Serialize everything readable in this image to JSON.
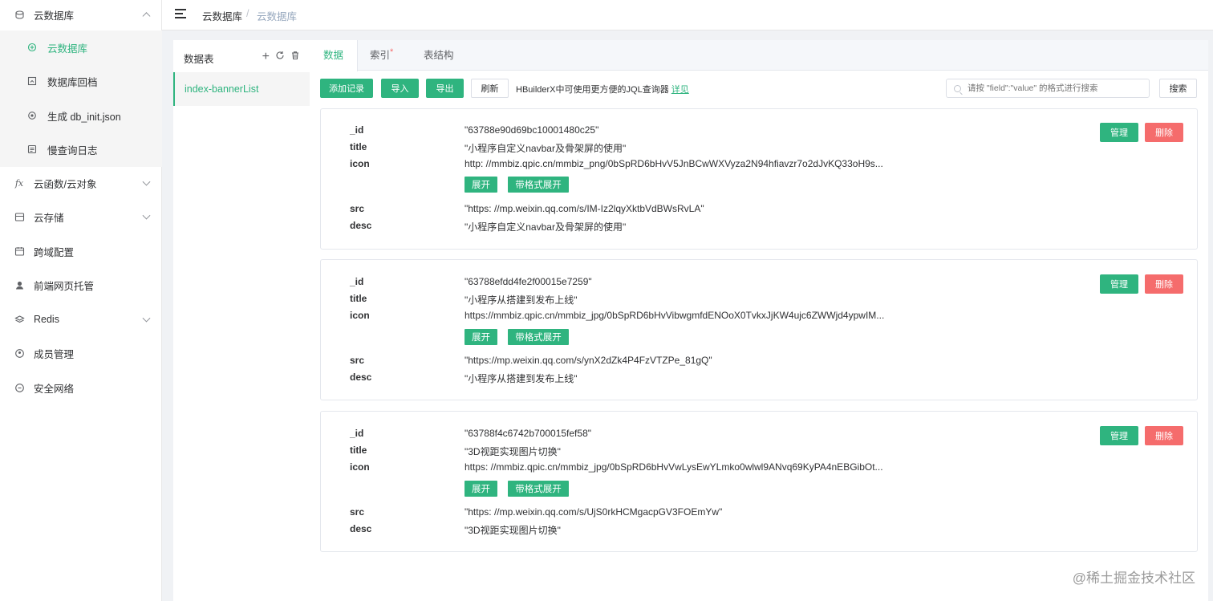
{
  "sidebar": {
    "top_item": {
      "label": "云数据库",
      "icon": "database-icon"
    },
    "sub_items": [
      {
        "label": "云数据库",
        "icon": "database-icon",
        "active": true
      },
      {
        "label": "数据库回档",
        "icon": "restore-icon"
      },
      {
        "label": "生成 db_init.json",
        "icon": "settings-icon"
      },
      {
        "label": "慢查询日志",
        "icon": "log-icon"
      }
    ],
    "items": [
      {
        "label": "云函数/云对象",
        "icon": "function-icon",
        "glyph": "fx",
        "expandable": true
      },
      {
        "label": "云存储",
        "icon": "storage-icon",
        "expandable": true
      },
      {
        "label": "跨域配置",
        "icon": "calendar-icon",
        "expandable": false
      },
      {
        "label": "前端网页托管",
        "icon": "host-icon",
        "expandable": false
      },
      {
        "label": "Redis",
        "icon": "redis-icon",
        "expandable": true
      },
      {
        "label": "成员管理",
        "icon": "member-icon",
        "expandable": false
      },
      {
        "label": "安全网络",
        "icon": "security-icon",
        "expandable": false
      }
    ]
  },
  "header": {
    "breadcrumb": [
      "云数据库",
      "云数据库"
    ],
    "separator": "/"
  },
  "table_panel": {
    "title": "数据表",
    "add": "+",
    "selected_table": "index-bannerList"
  },
  "tabs": [
    {
      "label": "数据",
      "active": true
    },
    {
      "label": "索引",
      "star": "*"
    },
    {
      "label": "表结构"
    }
  ],
  "toolbar": {
    "add_record": "添加记录",
    "import": "导入",
    "export": "导出",
    "refresh": "刷新",
    "hint": "HBuilderX中可使用更方便的JQL查询器",
    "hint_link": "详见",
    "search_placeholder": "请按 \"field\":\"value\" 的格式进行搜索",
    "search_button": "搜索"
  },
  "record_actions": {
    "manage": "管理",
    "delete": "删除",
    "expand": "展开",
    "expand_formatted": "带格式展开"
  },
  "field_keys": {
    "id": "_id",
    "title": "title",
    "icon": "icon",
    "src": "src",
    "desc": "desc"
  },
  "records": [
    {
      "id": "\"63788e90d69bc10001480c25\"",
      "title": "\"小程序自定义navbar及骨架屏的使用\"",
      "icon": "http: //mmbiz.qpic.cn/mmbiz_png/0bSpRD6bHvV5JnBCwWXVyza2N94hfiavzr7o2dJvKQ33oH9s...",
      "src": "\"https: //mp.weixin.qq.com/s/IM-Iz2lqyXktbVdBWsRvLA\"",
      "desc": "\"小程序自定义navbar及骨架屏的使用\""
    },
    {
      "id": "\"63788efdd4fe2f00015e7259\"",
      "title": "\"小程序从搭建到发布上线\"",
      "icon": "https://mmbiz.qpic.cn/mmbiz_jpg/0bSpRD6bHvVibwgmfdENOoX0TvkxJjKW4ujc6ZWWjd4ypwIM...",
      "src": "\"https://mp.weixin.qq.com/s/ynX2dZk4P4FzVTZPe_81gQ\"",
      "desc": "\"小程序从搭建到发布上线\""
    },
    {
      "id": "\"63788f4c6742b700015fef58\"",
      "title": "\"3D视距实现图片切换\"",
      "icon": "https: //mmbiz.qpic.cn/mmbiz_jpg/0bSpRD6bHvVwLysEwYLmko0wlwl9ANvq69KyPA4nEBGibOt...",
      "src": "\"https: //mp.weixin.qq.com/s/UjS0rkHCMgacpGV3FOEmYw\"",
      "desc": "\"3D视距实现图片切换\""
    }
  ],
  "watermark": "@稀土掘金技术社区",
  "colors": {
    "accent": "#2fb47f",
    "danger": "#f56c6c",
    "bg": "#f0f2f5"
  }
}
